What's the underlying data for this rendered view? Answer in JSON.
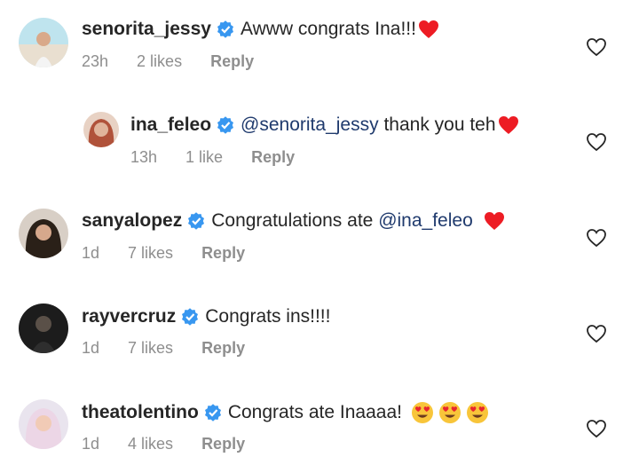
{
  "comments": [
    {
      "username": "senorita_jessy",
      "text": "Awww congrats Ina!!!",
      "mention": "",
      "time": "23h",
      "likes": "2 likes",
      "reply": "Reply",
      "emoji": "heart",
      "avatar": "beach"
    },
    {
      "username": "ina_feleo",
      "mention": "@senorita_jessy",
      "text": " thank you teh",
      "time": "13h",
      "likes": "1 like",
      "reply": "Reply",
      "emoji": "heart",
      "avatar": "redhead"
    },
    {
      "username": "sanyalopez",
      "text": "Congratulations ate ",
      "mention": "@ina_feleo",
      "time": "1d",
      "likes": "7 likes",
      "reply": "Reply",
      "emoji": "heart",
      "avatar": "dark-hair"
    },
    {
      "username": "rayvercruz",
      "text": "Congrats ins!!!!",
      "mention": "",
      "time": "1d",
      "likes": "7 likes",
      "reply": "Reply",
      "emoji": "none",
      "avatar": "dark-photo"
    },
    {
      "username": "theatolentino",
      "text": "Congrats ate Inaaaa!",
      "mention": "",
      "time": "1d",
      "likes": "4 likes",
      "reply": "Reply",
      "emoji": "heart-eyes x3",
      "avatar": "blonde"
    }
  ],
  "colors": {
    "verified": "#3897f0",
    "heart": "#ed1c24",
    "meta": "#8e8e8e",
    "mention": "#1f3a6d"
  },
  "icons": {
    "verified": "verified-badge-icon",
    "like": "heart-outline-icon"
  }
}
